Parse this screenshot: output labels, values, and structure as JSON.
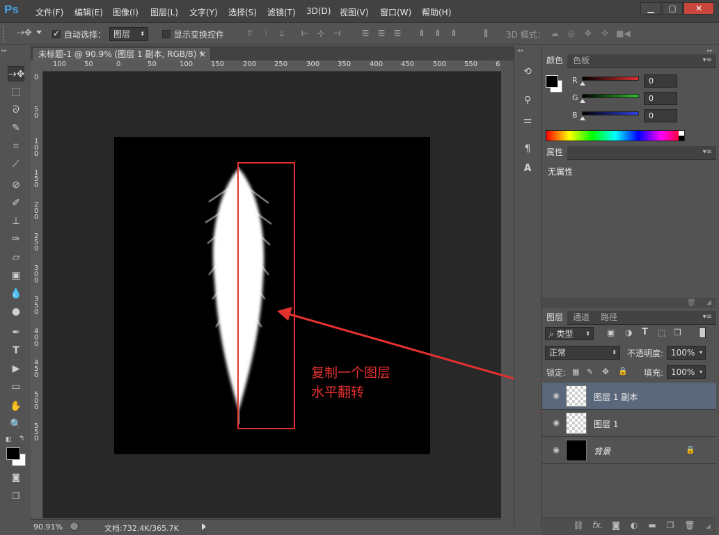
{
  "app": {
    "logo": "Ps"
  },
  "menu": [
    "文件(F)",
    "编辑(E)",
    "图像(I)",
    "图层(L)",
    "文字(Y)",
    "选择(S)",
    "滤镜(T)",
    "3D(D)",
    "视图(V)",
    "窗口(W)",
    "帮助(H)"
  ],
  "window_controls": {
    "minimize": "▁",
    "maximize": "▢",
    "close": "✕"
  },
  "options": {
    "auto_select_label": "自动选择：",
    "auto_select_checked": true,
    "auto_select_target": "图层",
    "show_transform_label": "显示变换控件",
    "mode_3d_label": "3D 模式："
  },
  "document": {
    "tab_title": "未标题-1 @ 90.9% (图层 1 副本, RGB/8) *",
    "tab_close": "×",
    "ruler_h": [
      "100",
      "50",
      "0",
      "50",
      "100",
      "150",
      "200",
      "250",
      "300",
      "350",
      "400",
      "450",
      "500",
      "550",
      "6"
    ],
    "ruler_v": [
      "0",
      "5 0",
      "1 0 0",
      "1 5 0",
      "2 0 0",
      "2 5 0",
      "3 0 0",
      "3 5 0",
      "4 0 0",
      "4 5 0",
      "5 0 0",
      "5 5 0"
    ],
    "annotation_line1": "复制一个图层",
    "annotation_line2": "水平翻转"
  },
  "status": {
    "zoom": "90.91%",
    "doc_info": "文档:732.4K/365.7K"
  },
  "color_panel": {
    "tabs": [
      "颜色",
      "色板"
    ],
    "channels": [
      {
        "label": "R",
        "value": "0",
        "color": "#e03030"
      },
      {
        "label": "G",
        "value": "0",
        "color": "#30c030"
      },
      {
        "label": "B",
        "value": "0",
        "color": "#3040e0"
      }
    ]
  },
  "properties_panel": {
    "tab": "属性",
    "empty_text": "无属性"
  },
  "layers_panel": {
    "tabs": [
      "图层",
      "通道",
      "路径"
    ],
    "filter_kind": "类型",
    "blend_mode": "正常",
    "opacity_label": "不透明度:",
    "opacity_value": "100%",
    "lock_label": "锁定:",
    "fill_label": "填充:",
    "fill_value": "100%",
    "layers": [
      {
        "name": "图层 1 副本",
        "selected": true
      },
      {
        "name": "图层 1",
        "selected": false
      },
      {
        "name": "背景",
        "selected": false
      }
    ]
  },
  "colors": {
    "accent_red": "#e53030",
    "selected_layer": "#5b677a"
  }
}
